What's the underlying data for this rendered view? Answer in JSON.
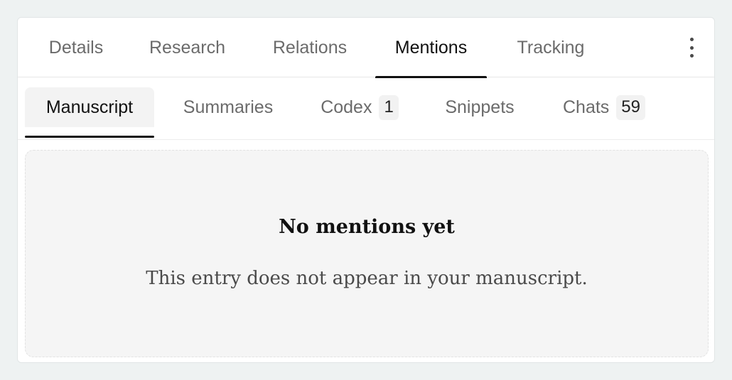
{
  "tabs": {
    "details": "Details",
    "research": "Research",
    "relations": "Relations",
    "mentions": "Mentions",
    "tracking": "Tracking",
    "active": "Mentions"
  },
  "more_menu_icon": "vertical-ellipsis-icon",
  "subtabs": {
    "manuscript": {
      "label": "Manuscript"
    },
    "summaries": {
      "label": "Summaries"
    },
    "codex": {
      "label": "Codex",
      "count": "1"
    },
    "snippets": {
      "label": "Snippets"
    },
    "chats": {
      "label": "Chats",
      "count": "59"
    },
    "active": "Manuscript"
  },
  "empty_state": {
    "title": "No mentions yet",
    "description": "This entry does not appear in your manuscript."
  },
  "colors": {
    "page_background": "#eef2f2",
    "panel_background": "#ffffff",
    "active_text": "#111111",
    "inactive_text": "#6b6b6b",
    "empty_background": "#f5f5f5"
  }
}
